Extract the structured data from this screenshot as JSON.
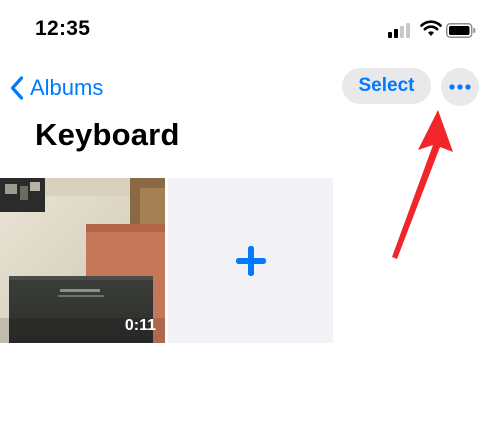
{
  "status_bar": {
    "time": "12:35"
  },
  "nav": {
    "back_label": "Albums",
    "select_label": "Select",
    "more_icon": "ellipsis-icon"
  },
  "album": {
    "title": "Keyboard",
    "items": [
      {
        "type": "video",
        "duration": "0:11"
      },
      {
        "type": "add",
        "icon": "plus-icon"
      }
    ]
  },
  "colors": {
    "accent": "#007aff",
    "button_bg": "#e9e9ec",
    "tile_bg": "#f2f2f7",
    "annotation_arrow": "#f0262b"
  }
}
